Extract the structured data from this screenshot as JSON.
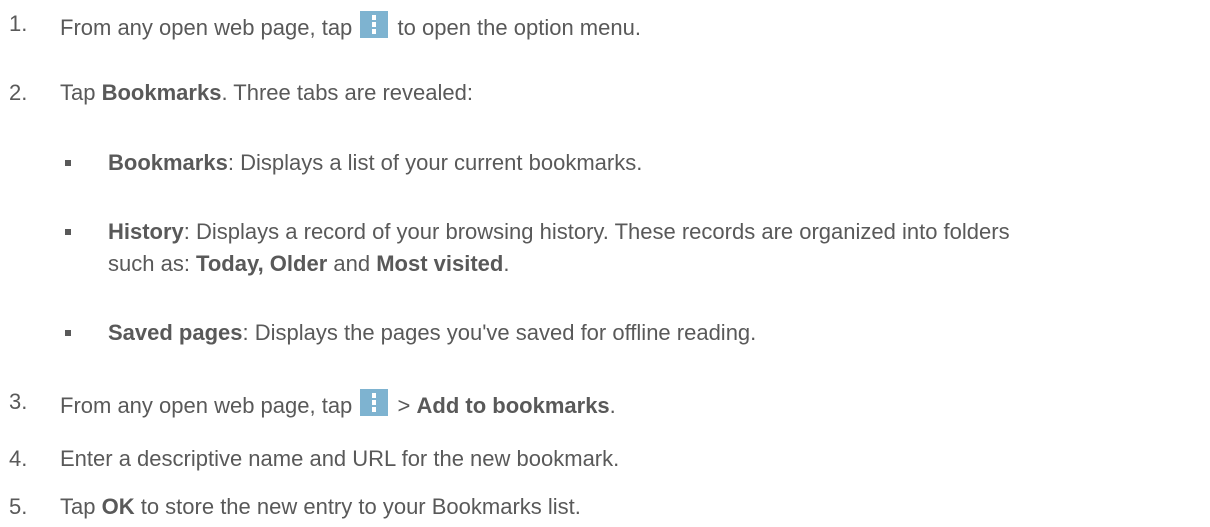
{
  "steps": [
    {
      "number": "1.",
      "before": "From any open web page, tap",
      "icon": "more-options-icon",
      "after": "to open the option menu."
    },
    {
      "number": "2.",
      "pre": "Tap ",
      "bold": "Bookmarks",
      "post": ". Three tabs are revealed:"
    },
    {
      "number": "3.",
      "before": "From any open web page, tap",
      "icon": "more-options-icon",
      "mid": ">",
      "bold": "Add to bookmarks",
      "post": "."
    },
    {
      "number": "4.",
      "text": "Enter a descriptive name and URL for the new bookmark."
    },
    {
      "number": "5.",
      "pre": "Tap ",
      "bold": "OK",
      "post": " to store the new entry to your Bookmarks list."
    }
  ],
  "tabs": [
    {
      "bold": "Bookmarks",
      "text": ": Displays a list of your current bookmarks."
    },
    {
      "bold": "History",
      "text": ": Displays a record of your browsing history. These records are organized into folders",
      "line2_pre": "such as: ",
      "line2_bold1": "Today, Older",
      "line2_mid": " and ",
      "line2_bold2": "Most visited",
      "line2_post": "."
    },
    {
      "bold": "Saved pages",
      "text": ": Displays the pages you've saved for offline reading."
    }
  ],
  "colors": {
    "text": "#595959",
    "icon_bg": "#7eb3d0"
  }
}
